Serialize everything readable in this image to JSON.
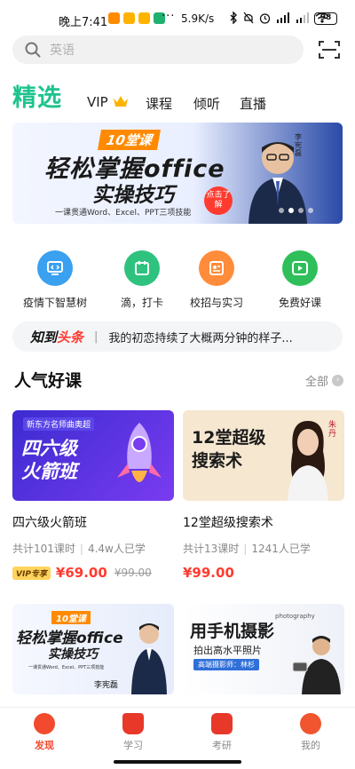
{
  "status_bar": {
    "time": "晚上7:41",
    "speed": "5.9K/s",
    "battery": "98"
  },
  "search": {
    "placeholder": "英语"
  },
  "tabs": {
    "main": "精选",
    "items": [
      "VIP",
      "课程",
      "倾听",
      "直播"
    ]
  },
  "banner": {
    "badge": "10堂课",
    "line1": "轻松掌握office",
    "line2": "实操技巧",
    "subtitle": "一课贯通Word、Excel、PPT三项技能",
    "cta": "点击了解",
    "teacher": "李宪磊"
  },
  "quick_entries": [
    {
      "label": "疫情下智慧树",
      "color": "#3aa0f0",
      "icon": "monitor-code-icon"
    },
    {
      "label": "滴，打卡",
      "color": "#2ec27e",
      "icon": "calendar-icon"
    },
    {
      "label": "校招与实习",
      "color": "#ff8c3a",
      "icon": "id-card-icon"
    },
    {
      "label": "免费好课",
      "color": "#2fbf5a",
      "icon": "play-icon"
    }
  ],
  "news": {
    "brand_a": "知到",
    "brand_b": "头条",
    "separator": "|",
    "text": "我的初恋持续了大概两分钟的样子..."
  },
  "section": {
    "title": "人气好课",
    "all": "全部"
  },
  "courses": [
    {
      "title": "四六级火箭班",
      "lessons": "共计101课时",
      "learners": "4.4w人已学",
      "vip": "VIP专享",
      "price": "¥69.00",
      "old_price": "¥99.00",
      "thumb_top": "新东方名师曲奥超",
      "thumb_main": "四六级火箭班"
    },
    {
      "title": "12堂超级搜索术",
      "lessons": "共计13课时",
      "learners": "1241人已学",
      "price": "¥99.00",
      "thumb_main": "12堂超级搜索术",
      "thumb_name": "朱丹"
    },
    {
      "thumb_badge": "10堂课",
      "thumb_line1": "轻松掌握office",
      "thumb_line2": "实操技巧",
      "thumb_sub": "一课贯通Word、Excel、PPT三项技能",
      "thumb_name": "李宪磊"
    },
    {
      "thumb_tag": "photography",
      "thumb_line1": "用手机摄影",
      "thumb_line2": "拍出高水平照片",
      "thumb_sub": "高端摄影师：林杉"
    }
  ],
  "bottom_nav": [
    {
      "label": "发现",
      "active": true
    },
    {
      "label": "学习",
      "active": false
    },
    {
      "label": "考研",
      "active": false
    },
    {
      "label": "我的",
      "active": false
    }
  ]
}
